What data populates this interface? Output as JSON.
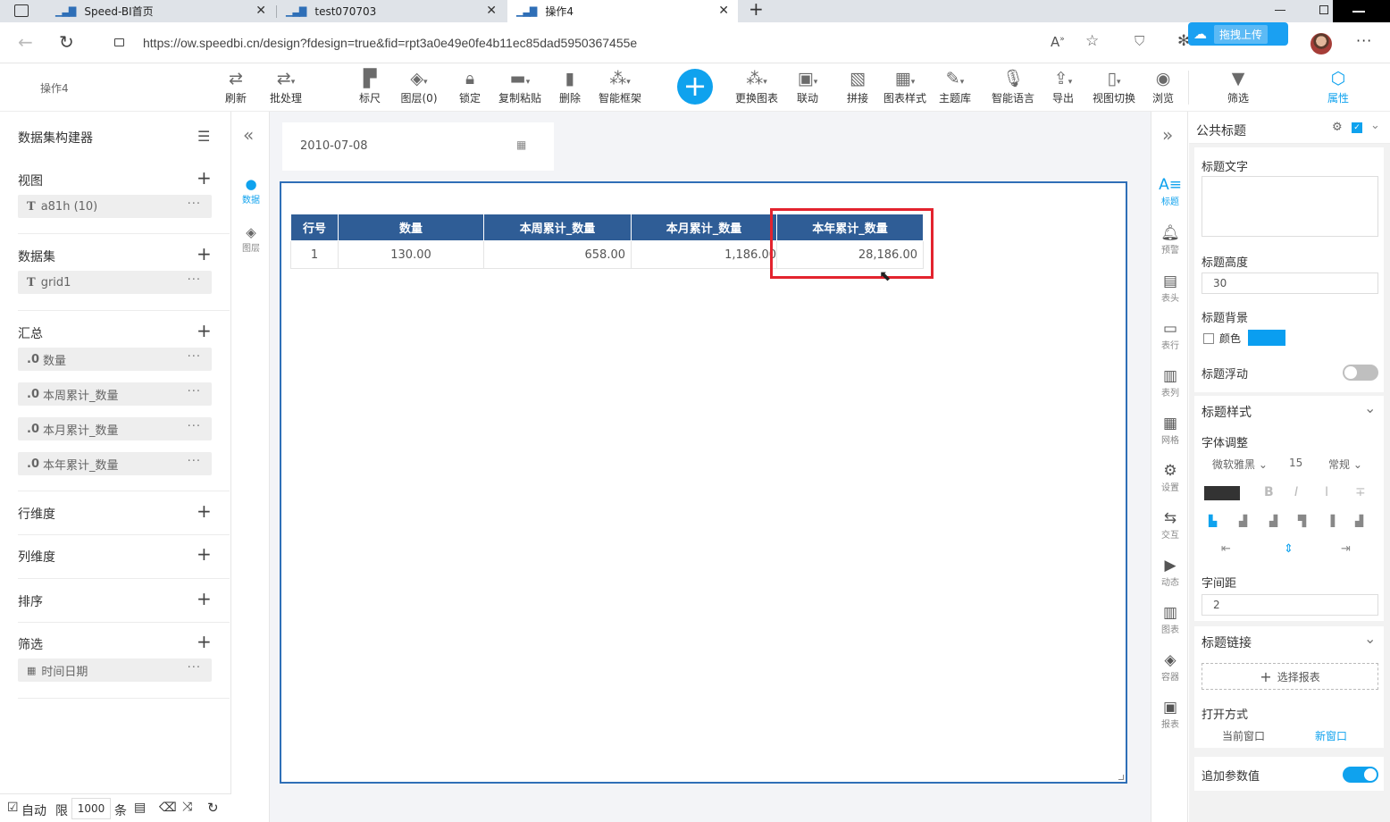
{
  "browser": {
    "tabs": [
      {
        "title": "Speed-BI首页"
      },
      {
        "title": "test070703"
      },
      {
        "title": "操作4"
      }
    ],
    "url": "https://ow.speedbi.cn/design?fdesign=true&fid=rpt3a0e49e0fe4b11ec85dad5950367455e",
    "upload_badge": "拖拽上传"
  },
  "toolbar": {
    "page_name": "操作4",
    "buttons": [
      {
        "label": "刷新",
        "icon": "refresh-icon"
      },
      {
        "label": "批处理",
        "icon": "batch-icon"
      },
      {
        "label": "标尺",
        "icon": "ruler-icon"
      },
      {
        "label": "图层(0)",
        "icon": "layers-icon"
      },
      {
        "label": "锁定",
        "icon": "lock-icon"
      },
      {
        "label": "复制粘贴",
        "icon": "copy-icon"
      },
      {
        "label": "删除",
        "icon": "trash-icon"
      },
      {
        "label": "智能框架",
        "icon": "frame-icon"
      },
      {
        "label": "更换图表",
        "icon": "chart-swap-icon"
      },
      {
        "label": "联动",
        "icon": "link-icon"
      },
      {
        "label": "拼接",
        "icon": "join-icon"
      },
      {
        "label": "图表样式",
        "icon": "style-icon"
      },
      {
        "label": "主题库",
        "icon": "theme-icon"
      },
      {
        "label": "智能语言",
        "icon": "mic-icon"
      },
      {
        "label": "导出",
        "icon": "export-icon"
      },
      {
        "label": "视图切换",
        "icon": "phone-icon"
      },
      {
        "label": "浏览",
        "icon": "eye-icon"
      },
      {
        "label": "筛选",
        "icon": "filter-icon"
      },
      {
        "label": "属性",
        "icon": "property-icon"
      }
    ]
  },
  "left_panel": {
    "title": "数据集构建器",
    "sections": [
      {
        "label": "视图",
        "items": [
          {
            "type": "T",
            "label": "a81h (10)"
          }
        ]
      },
      {
        "label": "数据集",
        "items": [
          {
            "type": "T",
            "label": "grid1"
          }
        ]
      },
      {
        "label": "汇总",
        "items": [
          {
            "type": ".0",
            "label": "数量"
          },
          {
            "type": ".0",
            "label": "本周累计_数量"
          },
          {
            "type": ".0",
            "label": "本月累计_数量"
          },
          {
            "type": ".0",
            "label": "本年累计_数量"
          }
        ]
      },
      {
        "label": "行维度",
        "items": []
      },
      {
        "label": "列维度",
        "items": []
      },
      {
        "label": "排序",
        "items": []
      },
      {
        "label": "筛选",
        "items": [
          {
            "type": "cal",
            "label": "时间日期"
          }
        ]
      }
    ],
    "footer": {
      "auto_label": "自动",
      "limit_label": "限",
      "limit_value": "1000",
      "unit": "条"
    }
  },
  "side_strip": [
    {
      "label": "数据"
    },
    {
      "label": "图层"
    }
  ],
  "canvas": {
    "date_value": "2010-07-08",
    "table": {
      "headers": [
        "行号",
        "数量",
        "本周累计_数量",
        "本月累计_数量",
        "本年累计_数量"
      ],
      "rows": [
        [
          "1",
          "130.00",
          "658.00",
          "1,186.00",
          "28,186.00"
        ]
      ]
    }
  },
  "right_strip": [
    {
      "label": "标题"
    },
    {
      "label": "预警"
    },
    {
      "label": "表头"
    },
    {
      "label": "表行"
    },
    {
      "label": "表列"
    },
    {
      "label": "网格"
    },
    {
      "label": "设置"
    },
    {
      "label": "交互"
    },
    {
      "label": "动态"
    },
    {
      "label": "图表"
    },
    {
      "label": "容器"
    },
    {
      "label": "报表"
    }
  ],
  "properties": {
    "header": "公共标题",
    "title_text_label": "标题文字",
    "title_text_value": "",
    "title_height_label": "标题高度",
    "title_height_value": "30",
    "title_bg_label": "标题背景",
    "color_label": "颜色",
    "bg_color": "#0a9ef0",
    "float_label": "标题浮动",
    "style_header": "标题样式",
    "font_adjust_label": "字体调整",
    "font_name": "微软雅黑",
    "font_size": "15",
    "font_weight": "常规",
    "text_color": "#333333",
    "letter_spacing_label": "字间距",
    "letter_spacing_value": "2",
    "link_header": "标题链接",
    "select_report_label": "选择报表",
    "open_mode_label": "打开方式",
    "open_current": "当前窗口",
    "open_new": "新窗口",
    "append_param_label": "追加参数值"
  }
}
